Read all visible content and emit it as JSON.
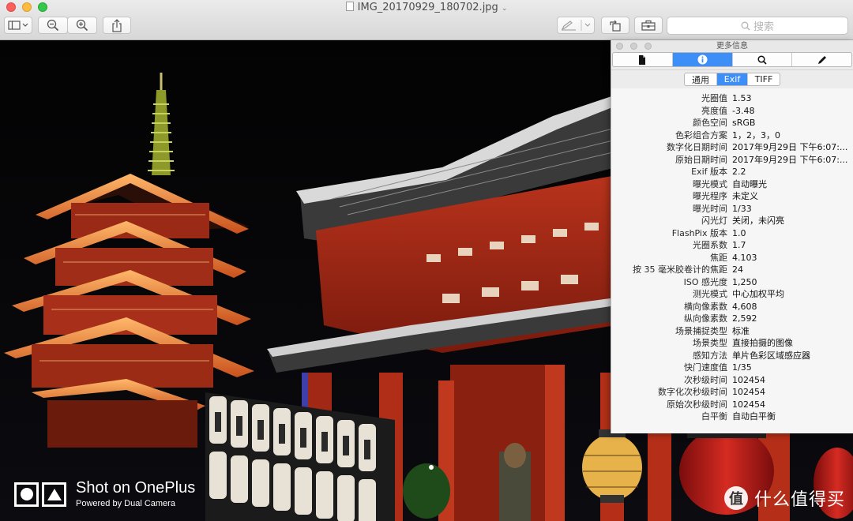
{
  "window": {
    "title": "IMG_20170929_180702.jpg"
  },
  "toolbar": {
    "search_placeholder": "搜索"
  },
  "photo": {
    "watermark_title": "Shot on OnePlus",
    "watermark_subtitle": "Powered by Dual Camera",
    "brand_icon": "值",
    "brand_text": "什么值得买"
  },
  "info_panel": {
    "title": "更多信息",
    "tabs": [
      "通用",
      "Exif",
      "TIFF"
    ],
    "selected_tab": "Exif",
    "rows": [
      {
        "key": "光圈值",
        "value": "1.53"
      },
      {
        "key": "亮度值",
        "value": "-3.48"
      },
      {
        "key": "颜色空间",
        "value": "sRGB"
      },
      {
        "key": "色彩组合方案",
        "value": "1，2，3，0"
      },
      {
        "key": "数字化日期时间",
        "value": "2017年9月29日 下午6:07:..."
      },
      {
        "key": "原始日期时间",
        "value": "2017年9月29日 下午6:07:..."
      },
      {
        "key": "Exif 版本",
        "value": "2.2"
      },
      {
        "key": "曝光模式",
        "value": "自动曝光"
      },
      {
        "key": "曝光程序",
        "value": "未定义"
      },
      {
        "key": "曝光时间",
        "value": "1/33"
      },
      {
        "key": "闪光灯",
        "value": "关闭，未闪亮"
      },
      {
        "key": "FlashPix 版本",
        "value": "1.0"
      },
      {
        "key": "光圈系数",
        "value": "1.7"
      },
      {
        "key": "焦距",
        "value": "4.103"
      },
      {
        "key": "按 35 毫米胶卷计的焦距",
        "value": "24"
      },
      {
        "key": "ISO 感光度",
        "value": "1,250"
      },
      {
        "key": "测光模式",
        "value": "中心加权平均"
      },
      {
        "key": "横向像素数",
        "value": "4,608"
      },
      {
        "key": "纵向像素数",
        "value": "2,592"
      },
      {
        "key": "场景捕捉类型",
        "value": "标准"
      },
      {
        "key": "场景类型",
        "value": "直接拍摄的图像"
      },
      {
        "key": "感知方法",
        "value": "单片色彩区域感应器"
      },
      {
        "key": "快门速度值",
        "value": "1/35"
      },
      {
        "key": "次秒级时间",
        "value": "102454"
      },
      {
        "key": "数字化次秒级时间",
        "value": "102454"
      },
      {
        "key": "原始次秒级时间",
        "value": "102454"
      },
      {
        "key": "白平衡",
        "value": "自动白平衡"
      }
    ]
  }
}
